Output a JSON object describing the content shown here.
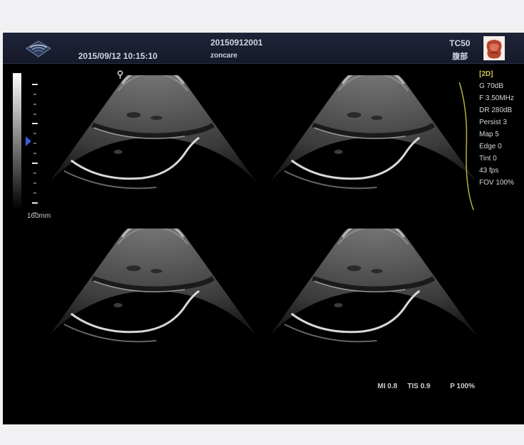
{
  "header": {
    "patient_id": "20150912001",
    "hospital": "zoncare",
    "datetime": "2015/09/12 10:15:10",
    "probe": "TC50",
    "exam_region": "腹部",
    "logo_icon": "probe-fan-logo-icon",
    "organ_icon": "abdomen-organ-icon"
  },
  "scale": {
    "depth_label": "160mm",
    "focus_marker_icon": "focus-triangle-icon"
  },
  "params": {
    "mode": "[2D]",
    "items": [
      "G 70dB",
      "F 3.50MHz",
      "DR 280dB",
      "Persist 3",
      "Map 5",
      "Edge 0",
      "Tint 0",
      "43 fps",
      "FOV 100%"
    ]
  },
  "bottom": {
    "mi": "MI 0.8",
    "tis": "TIS 0.9",
    "power": "P 100%"
  },
  "colors": {
    "header_bg": "#1f2439",
    "param_mode": "#d0c25a",
    "bracket": "#b8b23a",
    "focus_marker": "#3b5bd8"
  }
}
